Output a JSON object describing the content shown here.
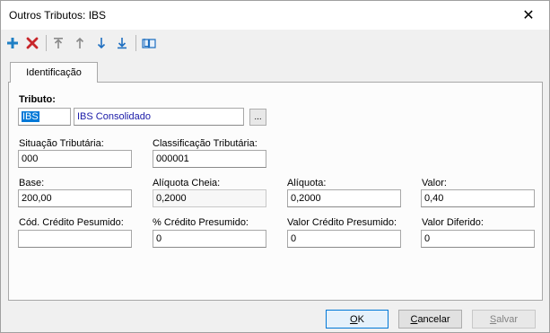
{
  "window": {
    "title": "Outros Tributos: IBS",
    "close_label": "✕"
  },
  "toolbar": {
    "icons": [
      "add-icon",
      "delete-icon",
      "move-first-icon",
      "move-up-icon",
      "move-down-icon",
      "move-last-icon",
      "book-icon"
    ]
  },
  "tabs": [
    {
      "label": "Identificação"
    }
  ],
  "form": {
    "tributo": {
      "label": "Tributo:",
      "code": "IBS",
      "description": "IBS Consolidado",
      "lookup_label": "..."
    },
    "situacao": {
      "label": "Situação Tributária:",
      "value": "000"
    },
    "classificacao": {
      "label": "Classificação Tributária:",
      "value": "000001"
    },
    "base": {
      "label": "Base:",
      "value": "200,00"
    },
    "aliquota_cheia": {
      "label": "Alíquota Cheia:",
      "value": "0,2000"
    },
    "aliquota": {
      "label": "Alíquota:",
      "value": "0,2000"
    },
    "valor": {
      "label": "Valor:",
      "value": "0,40"
    },
    "cod_credito": {
      "label": "Cód. Crédito Pesumido:",
      "value": ""
    },
    "pct_credito": {
      "label": "% Crédito Presumido:",
      "value": "0"
    },
    "valor_credito": {
      "label": "Valor Crédito Presumido:",
      "value": "0"
    },
    "valor_diferido": {
      "label": "Valor Diferido:",
      "value": "0"
    }
  },
  "buttons": {
    "ok": {
      "accel": "O",
      "rest": "K"
    },
    "cancel": {
      "accel": "C",
      "rest": "ancelar"
    },
    "save": {
      "accel": "S",
      "rest": "alvar"
    }
  },
  "colors": {
    "accent": "#0078d7",
    "add": "#1f7fc4",
    "delete": "#c8262b",
    "link_text": "#1a1aa8"
  }
}
